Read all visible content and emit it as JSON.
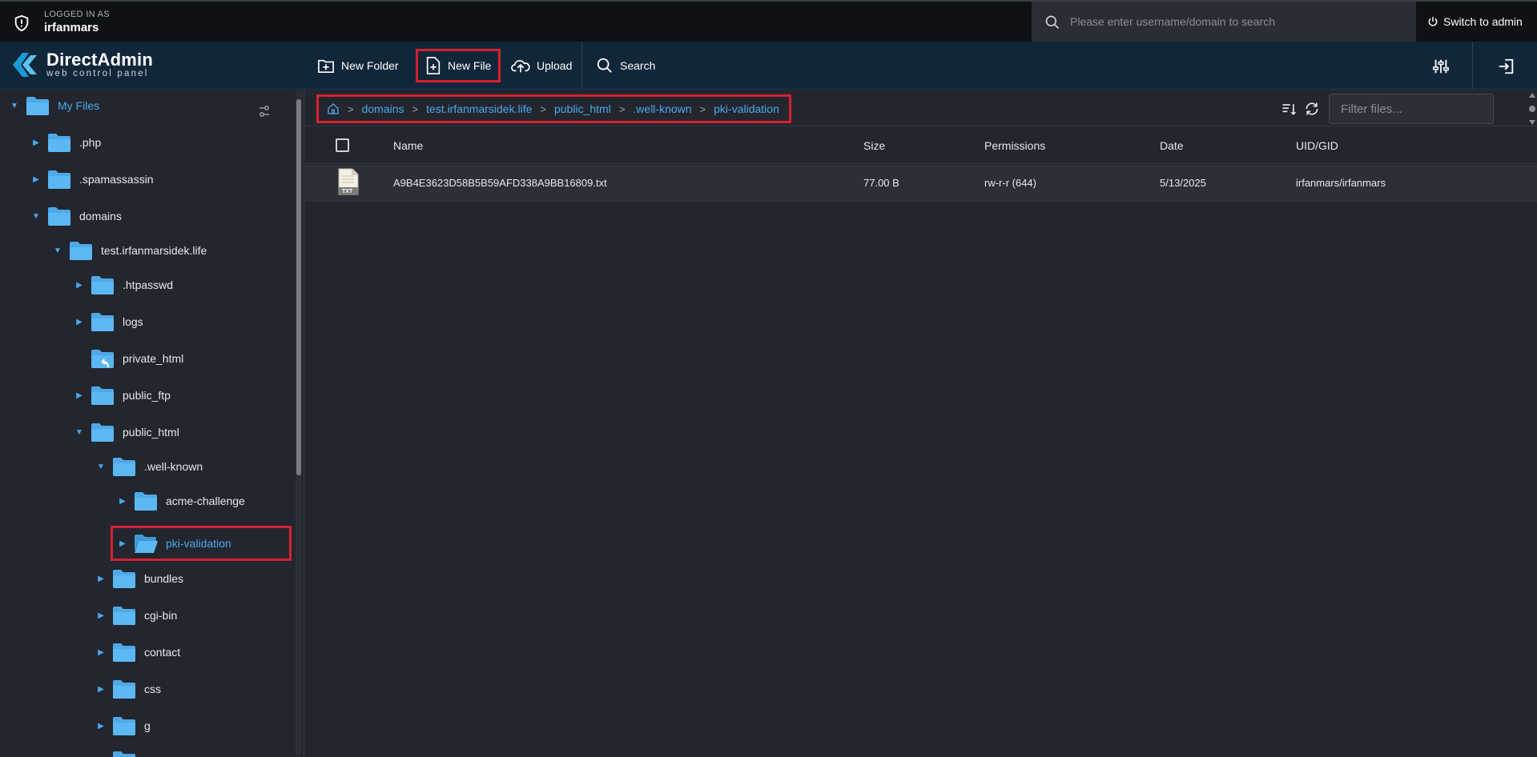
{
  "topbar": {
    "logged_label": "LOGGED IN AS",
    "username": "irfanmars",
    "search_placeholder": "Please enter username/domain to search",
    "switch_label": "Switch to admin"
  },
  "header": {
    "brand_name": "DirectAdmin",
    "brand_tagline": "web control panel",
    "toolbar": {
      "new_folder": "New Folder",
      "new_file": "New File",
      "upload": "Upload",
      "search": "Search"
    }
  },
  "sidebar": {
    "root_label": "My Files",
    "items": [
      {
        "label": ".php"
      },
      {
        "label": ".spamassassin"
      },
      {
        "label": "domains"
      },
      {
        "label": "test.irfanmarsidek.life"
      },
      {
        "label": ".htpasswd"
      },
      {
        "label": "logs"
      },
      {
        "label": "private_html"
      },
      {
        "label": "public_ftp"
      },
      {
        "label": "public_html"
      },
      {
        "label": ".well-known"
      },
      {
        "label": "acme-challenge"
      },
      {
        "label": "pki-validation"
      },
      {
        "label": "bundles"
      },
      {
        "label": "cgi-bin"
      },
      {
        "label": "contact"
      },
      {
        "label": "css"
      },
      {
        "label": "g"
      }
    ]
  },
  "breadcrumb": [
    "domains",
    "test.irfanmarsidek.life",
    "public_html",
    ".well-known",
    "pki-validation"
  ],
  "filter_placeholder": "Filter files...",
  "table": {
    "headers": {
      "name": "Name",
      "size": "Size",
      "permissions": "Permissions",
      "date": "Date",
      "uid": "UID/GID"
    },
    "rows": [
      {
        "icon_label": "TXT",
        "name": "A9B4E3623D58B5B59AFD338A9BB16809.txt",
        "size": "77.00 B",
        "permissions": "rw-r-r (644)",
        "date": "5/13/2025",
        "uid": "irfanmars/irfanmars"
      }
    ]
  },
  "colors": {
    "accent": "#4aa8ee",
    "highlight": "#d62030",
    "header_bg": "#12263a",
    "topbar_bg": "#0f1115",
    "panel_bg": "#23262e"
  }
}
